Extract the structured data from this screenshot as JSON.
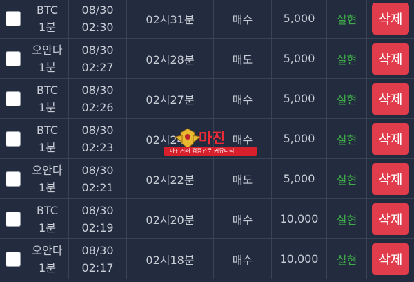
{
  "rows": [
    {
      "coin": "BTC",
      "interval": "1분",
      "date": "08/30",
      "clock": "02:30",
      "round": "02시31분",
      "side": "매수",
      "amount": "5,000",
      "status": "실현",
      "delete_label": "삭제"
    },
    {
      "coin": "오안다",
      "interval": "1분",
      "date": "08/30",
      "clock": "02:27",
      "round": "02시28분",
      "side": "매도",
      "amount": "5,000",
      "status": "실현",
      "delete_label": "삭제"
    },
    {
      "coin": "BTC",
      "interval": "1분",
      "date": "08/30",
      "clock": "02:26",
      "round": "02시27분",
      "side": "매수",
      "amount": "5,000",
      "status": "실현",
      "delete_label": "삭제"
    },
    {
      "coin": "BTC",
      "interval": "1분",
      "date": "08/30",
      "clock": "02:23",
      "round": "02시24분",
      "side": "매수",
      "amount": "5,000",
      "status": "실현",
      "delete_label": "삭제"
    },
    {
      "coin": "오안다",
      "interval": "1분",
      "date": "08/30",
      "clock": "02:21",
      "round": "02시22분",
      "side": "매도",
      "amount": "5,000",
      "status": "실현",
      "delete_label": "삭제"
    },
    {
      "coin": "BTC",
      "interval": "1분",
      "date": "08/30",
      "clock": "02:19",
      "round": "02시20분",
      "side": "매수",
      "amount": "10,000",
      "status": "실현",
      "delete_label": "삭제"
    },
    {
      "coin": "오안다",
      "interval": "1분",
      "date": "08/30",
      "clock": "02:17",
      "round": "02시18분",
      "side": "매수",
      "amount": "10,000",
      "status": "실현",
      "delete_label": "삭제"
    }
  ],
  "watermark": {
    "brand": "마진",
    "tagline": "마진거래 검증전문 커뮤니티"
  },
  "colors": {
    "background": "#232b3e",
    "status_green": "#3fae49",
    "delete_red": "#e03c4c"
  }
}
